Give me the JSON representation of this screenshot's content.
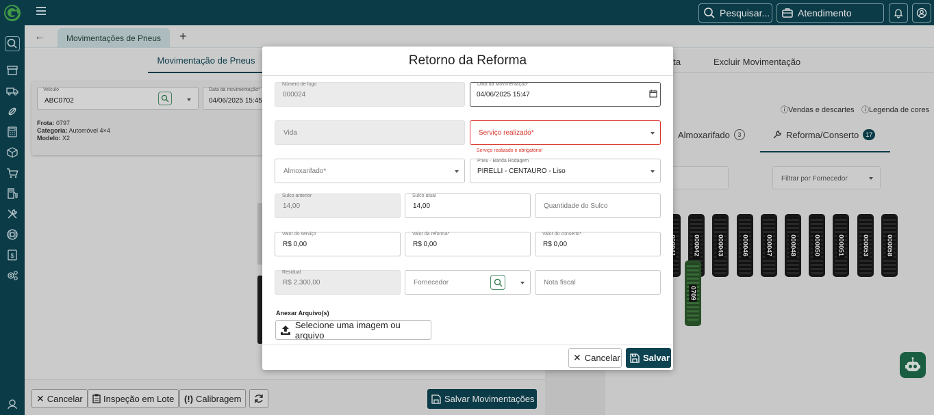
{
  "topbar": {
    "search_label": "Pesquisar...",
    "attendance_label": "Atendimento"
  },
  "tabbar": {
    "doc_tab": "Movimentações de Pneus",
    "plus": "+"
  },
  "left": {
    "section_tab": "Movimentação de Pneus",
    "vehicle_label": "Veículo",
    "vehicle_value": "ABC0702",
    "date_label": "Data da movimentação*",
    "date_value": "04/06/2025 15:45",
    "frota_label": "Frota:",
    "frota_value": "0797",
    "categoria_label": "Categoria:",
    "categoria_value": "Automóvel 4×4",
    "modelo_label": "Modelo:",
    "modelo_value": "X2"
  },
  "right": {
    "tab_partial": "ata",
    "tab_excluir": "Excluir Movimentação",
    "vendas": "Vendas e descartes",
    "legenda": "Legenda de cores",
    "tab_almox": "Almoxarifado",
    "almox_count": "3",
    "tab_reforma": "Reforma/Conserto",
    "reforma_count": "17",
    "filter_fornecedor": "Filtrar por Fornecedor",
    "tires_row1": [
      "000041",
      "000042",
      "000043",
      "000046",
      "000047",
      "000048",
      "000050",
      "000051",
      "000053",
      "000058"
    ],
    "tires_row2": [
      "0709"
    ]
  },
  "bottom": {
    "cancel": "Cancelar",
    "inspecao": "Inspeção em Lote",
    "calibragem": "Calibragem",
    "salvar": "Salvar Movimentações"
  },
  "modal": {
    "title": "Retorno da Reforma",
    "numero_fogo_label": "Número de fogo",
    "numero_fogo_value": "000024",
    "data_mov_label": "Data da Movimentação*",
    "data_mov_value": "04/06/2025 15:47",
    "vida_placeholder": "Vida",
    "servico_placeholder": "Serviço realizado*",
    "servico_error": "Serviço realizado é obrigatório!",
    "almox_placeholder": "Almoxarifado*",
    "pneu_label": "Pneu - Banda Rodagem",
    "pneu_value": "PIRELLI - CENTAURO - Liso",
    "sulco_anterior_label": "Sulco anterior",
    "sulco_anterior_value": "14,00",
    "sulco_atual_label": "Sulco atual",
    "sulco_atual_value": "14,00",
    "qtd_sulco_placeholder": "Quantidade do Sulco",
    "valor_servico_label": "Valor do serviço",
    "valor_servico_value": "R$ 0,00",
    "valor_reforma_label": "Valor da reforma*",
    "valor_reforma_value": "R$ 0,00",
    "valor_conserto_label": "Valor do conserto*",
    "valor_conserto_value": "R$ 0,00",
    "residual_label": "Residual",
    "residual_value": "R$ 2.300,00",
    "fornecedor_placeholder": "Fornecedor",
    "nota_placeholder": "Nota fiscal",
    "attach_label": "Anexar Arquivo(s)",
    "attach_button": "Selecione uma imagem ou arquivo",
    "cancel": "Cancelar",
    "save": "Salvar"
  },
  "colors": {
    "primary": "#0e4452",
    "error": "#d9342b",
    "accent_green": "#1e6b4b"
  }
}
